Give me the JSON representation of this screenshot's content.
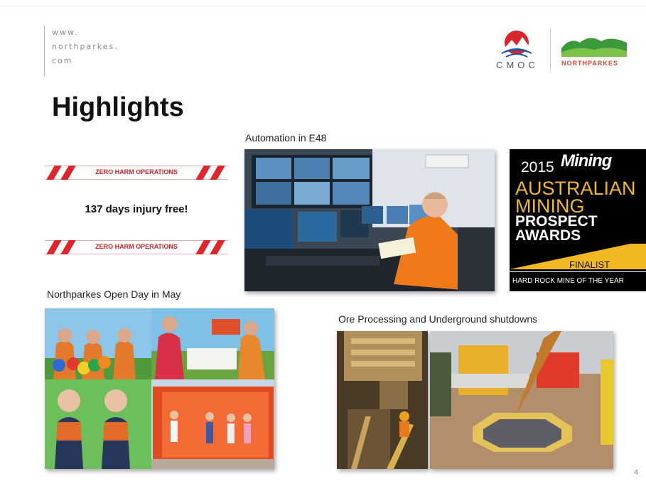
{
  "url": {
    "line1": "www.",
    "line2": "northparkes.",
    "line3": "com"
  },
  "logos": {
    "cmoc_text": "CMOC",
    "northparkes_text": "NORTHPARKES"
  },
  "title": "Highlights",
  "safety": {
    "banner_top": "ZERO HARM OPERATIONS",
    "injury_free": "137 days injury free!",
    "banner_bottom": "ZERO HARM OPERATIONS"
  },
  "captions": {
    "automation": "Automation in E48",
    "open_day": "Northparkes Open Day in May",
    "ore": "Ore Processing and Underground shutdowns"
  },
  "award": {
    "year": "2015",
    "magazine": "Mining",
    "line1": "AUSTRALIAN",
    "line2": "MINING",
    "line3": "PROSPECT",
    "line4": "AWARDS",
    "finalist": "FINALIST",
    "category": "HARD ROCK MINE OF THE YEAR"
  },
  "page_number": "4",
  "colors": {
    "banner_red": "#e0242b",
    "award_gold": "#f2b821",
    "np_green": "#3d9a3a",
    "cmoc_red": "#d9252b"
  }
}
